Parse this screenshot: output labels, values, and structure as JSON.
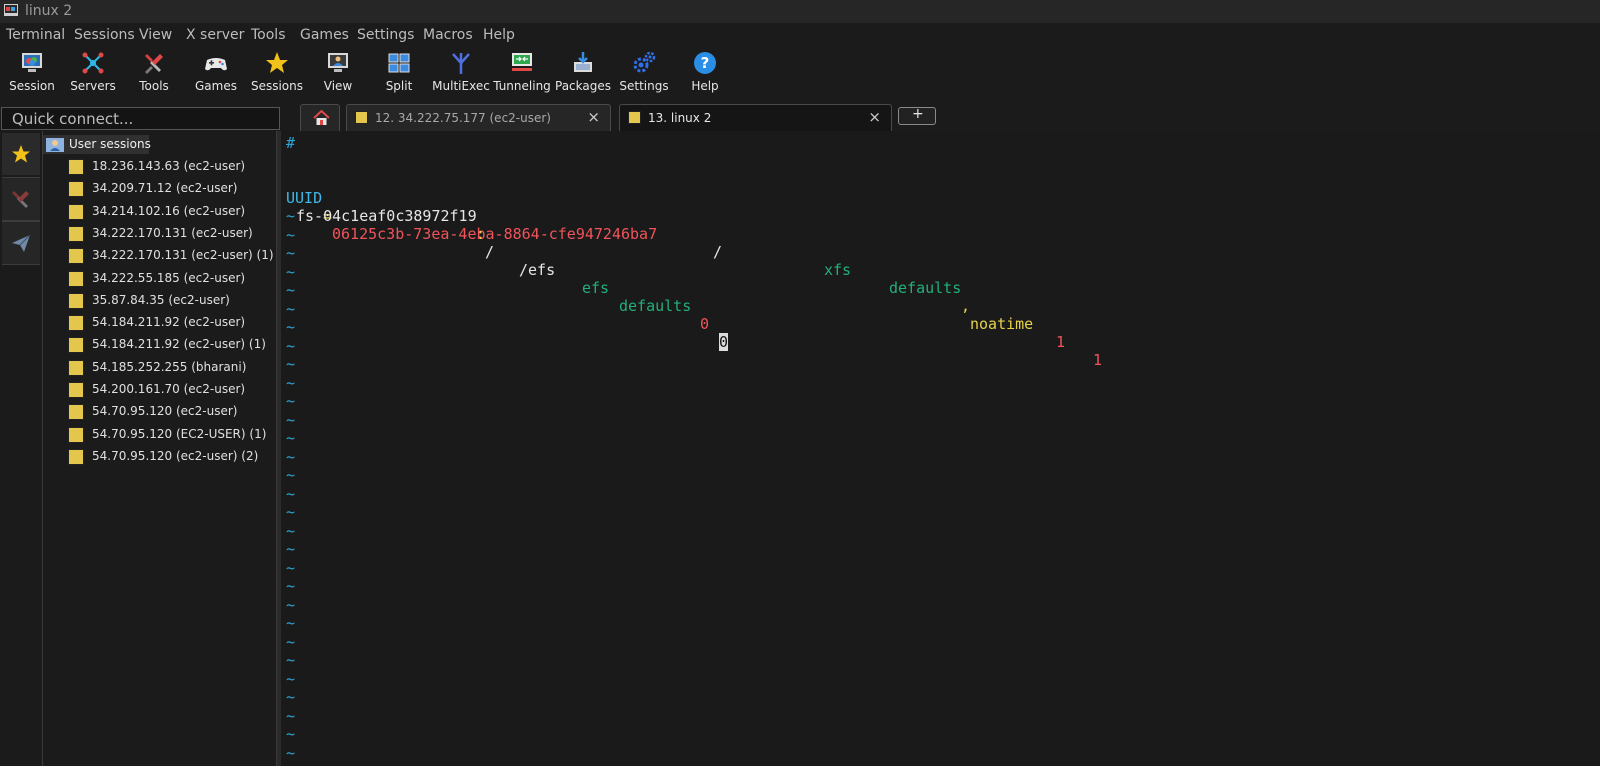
{
  "window": {
    "title": "linux 2"
  },
  "menu": [
    "Terminal",
    "Sessions",
    "View",
    "X server",
    "Tools",
    "Games",
    "Settings",
    "Macros",
    "Help"
  ],
  "toolbar": [
    {
      "label": "Session",
      "icon": "session-icon"
    },
    {
      "label": "Servers",
      "icon": "servers-icon"
    },
    {
      "label": "Tools",
      "icon": "tools-icon"
    },
    {
      "label": "Games",
      "icon": "gamepad-icon"
    },
    {
      "label": "Sessions",
      "icon": "star-icon"
    },
    {
      "label": "View",
      "icon": "view-icon"
    },
    {
      "label": "Split",
      "icon": "split-icon"
    },
    {
      "label": "MultiExec",
      "icon": "multiexec-icon"
    },
    {
      "label": "Tunneling",
      "icon": "tunneling-icon"
    },
    {
      "label": "Packages",
      "icon": "packages-icon"
    },
    {
      "label": "Settings",
      "icon": "settings-gears-icon"
    },
    {
      "label": "Help",
      "icon": "help-icon"
    }
  ],
  "quick_connect": {
    "placeholder": "Quick connect..."
  },
  "tabs": [
    {
      "label": "12. 34.222.75.177 (ec2-user)",
      "active": false
    },
    {
      "label": "13. linux 2",
      "active": true
    }
  ],
  "sessions": {
    "root_label": "User sessions",
    "items": [
      "18.236.143.63 (ec2-user)",
      "34.209.71.12 (ec2-user)",
      "34.214.102.16 (ec2-user)",
      "34.222.170.131 (ec2-user)",
      "34.222.170.131 (ec2-user) (1)",
      "34.222.55.185 (ec2-user)",
      "35.87.84.35 (ec2-user)",
      "54.184.211.92 (ec2-user)",
      "54.184.211.92 (ec2-user) (1)",
      "54.185.252.255 (bharani)",
      "54.200.161.70 (ec2-user)",
      "54.70.95.120 (ec2-user)",
      "54.70.95.120 (EC2-USER) (1)",
      "54.70.95.120 (ec2-user) (2)"
    ]
  },
  "terminal": {
    "comment": "#",
    "line1": {
      "uuid_key": "UUID",
      "uuid_eq": "=",
      "uuid_val": "06125c3b-73ea-4eba-8864-cfe947246ba7",
      "mount": "/",
      "fstype": "xfs",
      "opts_a": "defaults",
      "opts_comma": ",",
      "opts_b": "noatime",
      "dump": "1",
      "pass": "1"
    },
    "line2": {
      "device": "fs-04c1eaf0c38972f19",
      "colon": ":",
      "path": "/",
      "mount": "/efs",
      "fstype": "efs",
      "opts": "defaults",
      "dump": "0",
      "pass": "0"
    },
    "tilde": "~",
    "tilde_count": 30,
    "colors": {
      "uuid_key": "#40b8e6",
      "uuid_val": "#f0545a",
      "plain": "#e6e6e6",
      "green": "#21b07a",
      "yellow": "#e6d24a",
      "red": "#f0545a",
      "tilde": "#2aa6d6"
    }
  }
}
